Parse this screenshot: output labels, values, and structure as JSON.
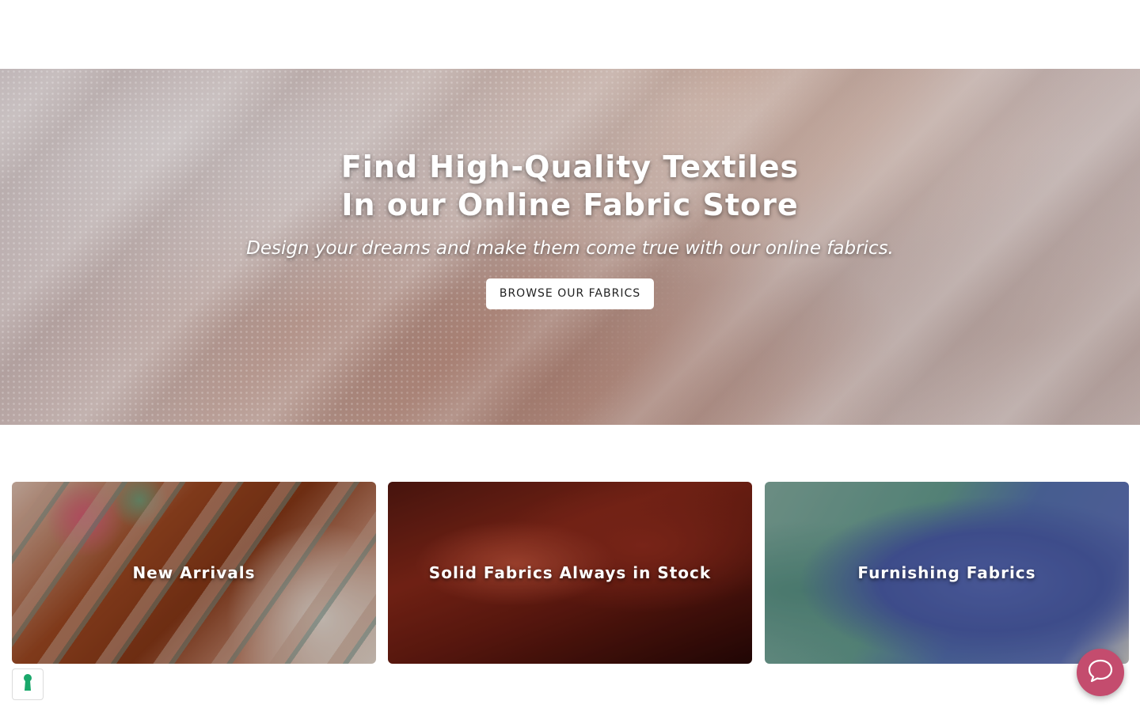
{
  "hero": {
    "title_line1": "Find High-Quality Textiles",
    "title_line2": "In our Online Fabric Store",
    "subtitle": "Design your dreams and make them come true with our online fabrics.",
    "cta_label": "BROWSE OUR FABRICS"
  },
  "categories": [
    {
      "label": "New Arrivals"
    },
    {
      "label": "Solid Fabrics Always in Stock"
    },
    {
      "label": "Furnishing Fabrics"
    }
  ],
  "widgets": {
    "privacy_icon": "keyhole-icon",
    "chat_icon": "chat-bubble-icon",
    "chat_color": "#c44c6e",
    "privacy_color": "#1aa86b"
  }
}
